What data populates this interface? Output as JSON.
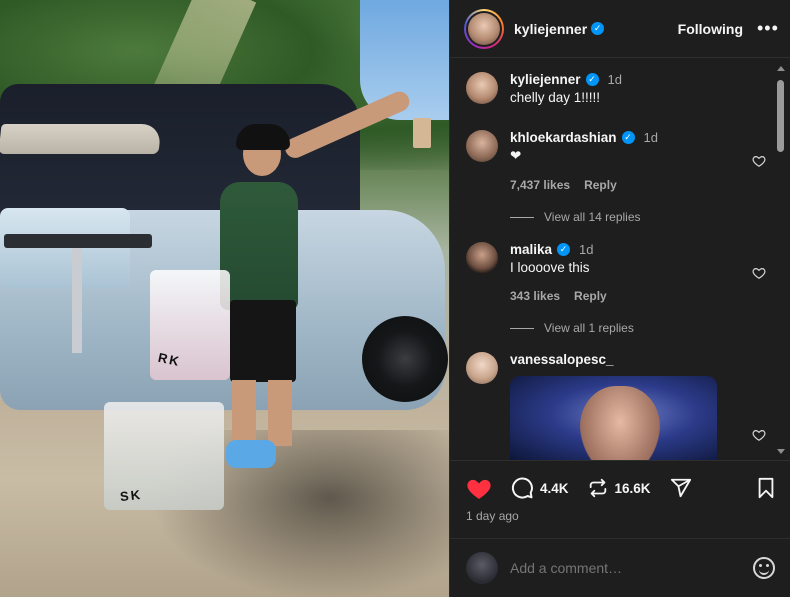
{
  "post": {
    "username": "kyliejenner",
    "follow_label": "Following",
    "more_label": "•••",
    "photo_bag_text_1": "RK",
    "photo_bag_text_2": "SK"
  },
  "comments": [
    {
      "user": "kyliejenner",
      "verified": true,
      "time": "1d",
      "text": "chelly day 1!!!!!",
      "likes": "",
      "reply": ""
    },
    {
      "user": "khloekardashian",
      "verified": true,
      "time": "1d",
      "text": "❤",
      "likes": "7,437 likes",
      "reply": "Reply",
      "view_replies": "View all 14 replies"
    },
    {
      "user": "malika",
      "verified": true,
      "time": "1d",
      "text": "I loooove this",
      "likes": "343 likes",
      "reply": "Reply",
      "view_replies": "View all 1 replies"
    },
    {
      "user": "vanessalopesc_",
      "verified": false,
      "time": "",
      "text": ""
    }
  ],
  "actions": {
    "comments_count": "4.4K",
    "reposts_count": "16.6K",
    "timestamp": "1 day ago"
  },
  "add_comment": {
    "placeholder": "Add a comment…"
  },
  "colors": {
    "like_red": "#ff3040",
    "verified_blue": "#0095f6"
  }
}
